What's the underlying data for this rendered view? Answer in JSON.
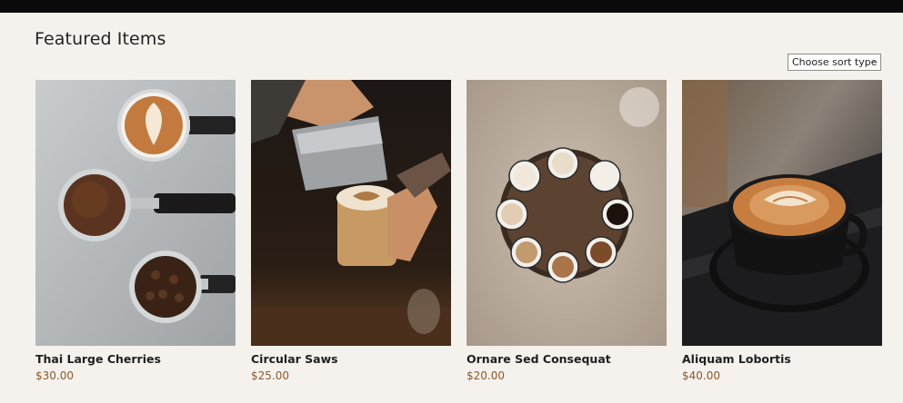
{
  "section": {
    "title": "Featured Items"
  },
  "sort": {
    "label": "Choose sort type"
  },
  "colors": {
    "background": "#f5f2ee",
    "price": "#8a5a2b",
    "top_bar": "#0a0a0a"
  },
  "products": [
    {
      "name": "Thai Large Cherries",
      "price": "$30.00",
      "image": "coffee-portafilters-photo"
    },
    {
      "name": "Circular Saws",
      "price": "$25.00",
      "image": "latte-pour-photo"
    },
    {
      "name": "Ornare Sed Consequat",
      "price": "$20.00",
      "image": "coffee-cups-tray-photo"
    },
    {
      "name": "Aliquam Lobortis",
      "price": "$40.00",
      "image": "latte-art-cup-photo"
    }
  ]
}
